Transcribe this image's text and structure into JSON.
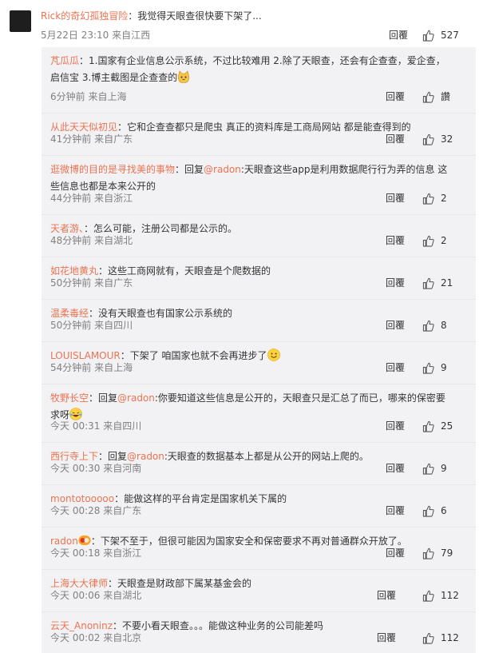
{
  "top": {
    "user": "Rick的奇幻孤独冒险",
    "text": "：我觉得天眼查很快要下架了...",
    "time": "5月22日 23:10 来自江西",
    "reply": "回覆",
    "likes": "527"
  },
  "replies": [
    {
      "user": "芃瓜瓜",
      "pre": "：1.国家有企业信息公示系统，不过比较难用 2.除了天眼查，还会有企查查，爱企查，启信宝 3.博主截图是企查查的",
      "mention": "",
      "post": "",
      "emoji": "cat",
      "meta": "6分钟前 来自上海",
      "reply": "回覆",
      "likes": "讚"
    },
    {
      "user": "从此天天似初见",
      "pre": "：它和企查查都只是爬虫 真正的资料库是工商局网站 都是能查得到的",
      "mention": "",
      "post": "",
      "emoji": "",
      "meta": "41分钟前 来自广东",
      "reply": "回覆",
      "likes": "32"
    },
    {
      "user": "逛微博的目的是寻找美的事物",
      "pre": "：回复",
      "mention": "@radon",
      "post": ":天眼查这些app是利用数据爬行行为弄的信息 这些信息也都是本来公开的",
      "emoji": "",
      "meta": "44分钟前 来自浙江",
      "reply": "回覆",
      "likes": "2"
    },
    {
      "user": "天者游、",
      "pre": "：怎么可能，注册公司都是公示的。",
      "mention": "",
      "post": "",
      "emoji": "",
      "meta": "48分钟前 来自湖北",
      "reply": "回覆",
      "likes": "2"
    },
    {
      "user": "如花地黄丸",
      "pre": "：这些工商网就有，天眼查是个爬数据的",
      "mention": "",
      "post": "",
      "emoji": "",
      "meta": "50分钟前 来自广东",
      "reply": "回覆",
      "likes": "21"
    },
    {
      "user": "温柔毒经",
      "pre": "：没有天眼查也有国家公示系统的",
      "mention": "",
      "post": "",
      "emoji": "",
      "meta": "50分钟前 来自四川",
      "reply": "回覆",
      "likes": "8"
    },
    {
      "user": "LOUISLAMOUR",
      "pre": "：下架了 咱国家也就不会再进步了",
      "mention": "",
      "post": "",
      "emoji": "smile",
      "meta": "54分钟前 来自上海",
      "reply": "回覆",
      "likes": "9"
    },
    {
      "user": "牧野长空",
      "pre": "：回复",
      "mention": "@radon",
      "post": ":你要知道这些信息是公开的，天眼查只是汇总了而已，哪来的保密要求呀",
      "emoji": "laugh",
      "meta": "今天 00:31 来自四川",
      "reply": "回覆",
      "likes": "25"
    },
    {
      "user": "西行寺上下",
      "pre": "：回复",
      "mention": "@radon",
      "post": ":天眼查的数据基本上都是从公开的网站上爬的。",
      "emoji": "",
      "meta": "今天 00:30 来自河南",
      "reply": "回覆",
      "likes": "9"
    },
    {
      "user": "montotooooo",
      "pre": "：能做这样的平台肯定是国家机关下属的",
      "mention": "",
      "post": "",
      "emoji": "",
      "meta": "今天 00:28 来自广东",
      "reply": "回覆",
      "likes": "6"
    },
    {
      "user": "radon",
      "pre": "：下架不至于，但很可能因为国家安全和保密要求不再对普通群众开放了。",
      "mention": "",
      "post": "",
      "emoji": "",
      "badge": true,
      "meta": "今天 00:18 来自浙江",
      "reply": "回覆",
      "likes": "79"
    },
    {
      "user": "上海大大律师",
      "pre": "：天眼查是财政部下属某基金会的",
      "mention": "",
      "post": "",
      "emoji": "",
      "meta": "今天 00:06 来自湖北",
      "reply": "回覆",
      "likes": "112"
    },
    {
      "user": "云天_Anoninz",
      "pre": "：不要小看天眼查。。。能做这种业务的公司能差吗",
      "mention": "",
      "post": "",
      "emoji": "",
      "meta": "今天 00:02 来自北京",
      "reply": "回覆",
      "likes": "112"
    }
  ]
}
